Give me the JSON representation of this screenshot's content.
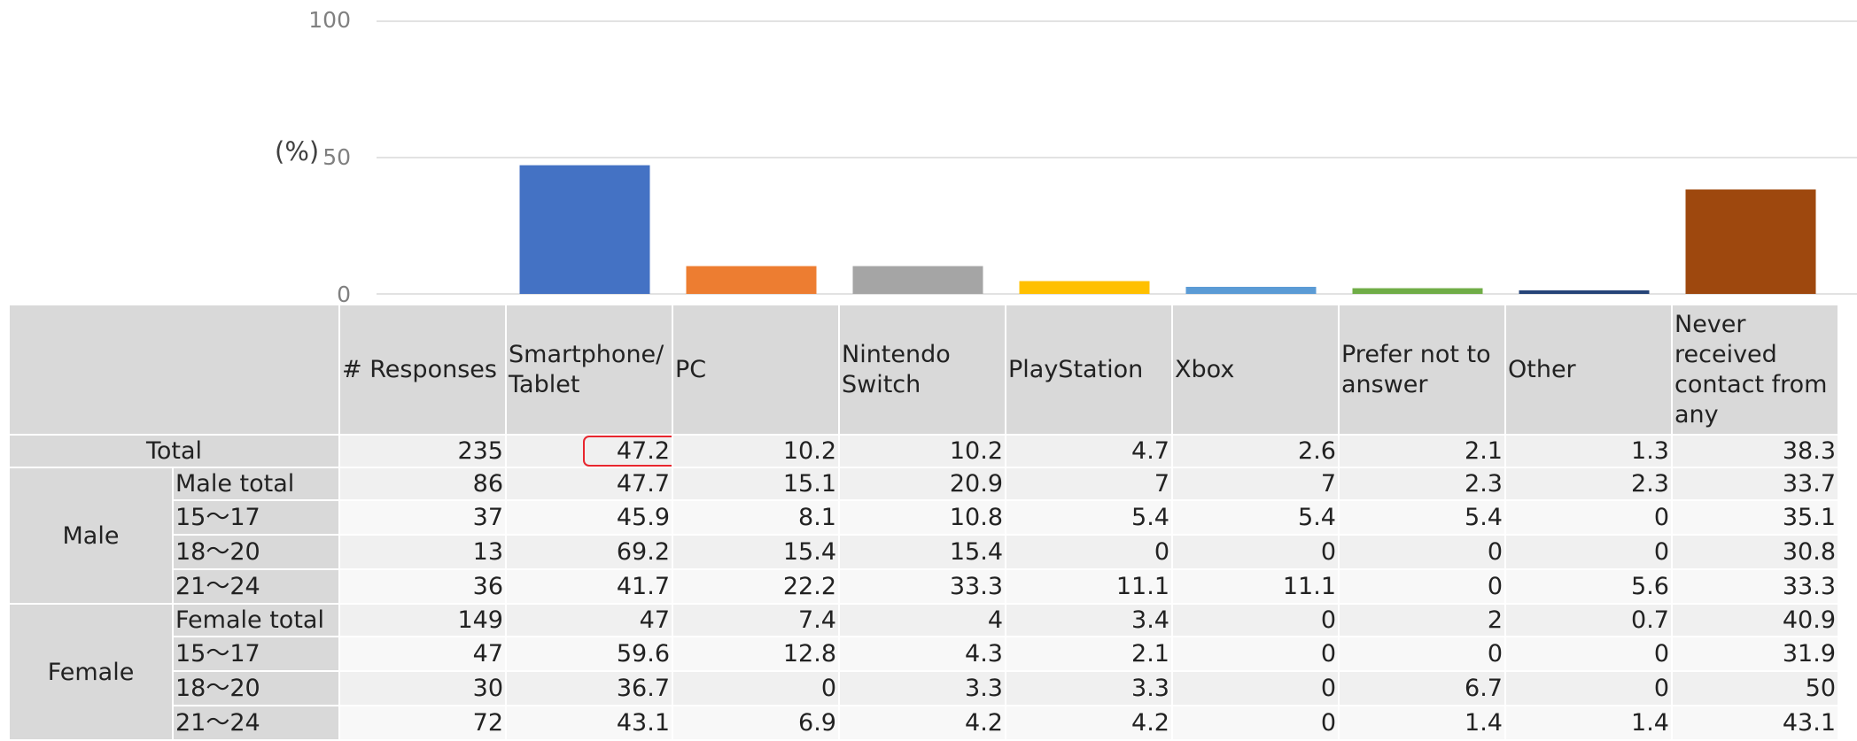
{
  "chart_data": {
    "type": "bar",
    "unit_label": "(%)",
    "y_ticks": [
      "100",
      "50",
      "0"
    ],
    "ylim": [
      0,
      100
    ],
    "grid": true,
    "categories": [
      "Smartphone/ Tablet",
      "PC",
      "Nintendo Switch",
      "PlayStation",
      "Xbox",
      "Prefer not to answer",
      "Other",
      "Never received contact from any"
    ],
    "values": [
      47.2,
      10.2,
      10.2,
      4.7,
      2.6,
      2.1,
      1.3,
      38.3
    ],
    "colors": [
      "#4472c4",
      "#ed7d31",
      "#a5a5a5",
      "#ffc000",
      "#5b9bd5",
      "#70ad47",
      "#264478",
      "#9e480e"
    ]
  },
  "table": {
    "header": {
      "responses": "# Responses",
      "c1": "Smartphone/ Tablet",
      "c2": "PC",
      "c3": "Nintendo Switch",
      "c4": "PlayStation",
      "c5": "Xbox",
      "c6": "Prefer not to answer",
      "c7": "Other",
      "c8": "Never received contact from any"
    },
    "total": {
      "label": "Total",
      "values": [
        "235",
        "47.2",
        "10.2",
        "10.2",
        "4.7",
        "2.6",
        "2.1",
        "1.3",
        "38.3"
      ]
    },
    "male": {
      "group": "Male",
      "rows": [
        {
          "label": "Male total",
          "values": [
            "86",
            "47.7",
            "15.1",
            "20.9",
            "7",
            "7",
            "2.3",
            "2.3",
            "33.7"
          ]
        },
        {
          "label": "15～17",
          "values": [
            "37",
            "45.9",
            "8.1",
            "10.8",
            "5.4",
            "5.4",
            "5.4",
            "0",
            "35.1"
          ]
        },
        {
          "label": "18～20",
          "values": [
            "13",
            "69.2",
            "15.4",
            "15.4",
            "0",
            "0",
            "0",
            "0",
            "30.8"
          ]
        },
        {
          "label": "21～24",
          "values": [
            "36",
            "41.7",
            "22.2",
            "33.3",
            "11.1",
            "11.1",
            "0",
            "5.6",
            "33.3"
          ]
        }
      ]
    },
    "female": {
      "group": "Female",
      "rows": [
        {
          "label": "Female total",
          "values": [
            "149",
            "47",
            "7.4",
            "4",
            "3.4",
            "0",
            "2",
            "0.7",
            "40.9"
          ]
        },
        {
          "label": "15～17",
          "values": [
            "47",
            "59.6",
            "12.8",
            "4.3",
            "2.1",
            "0",
            "0",
            "0",
            "31.9"
          ]
        },
        {
          "label": "18～20",
          "values": [
            "30",
            "36.7",
            "0",
            "3.3",
            "3.3",
            "0",
            "6.7",
            "0",
            "50"
          ]
        },
        {
          "label": "21～24",
          "values": [
            "72",
            "43.1",
            "6.9",
            "4.2",
            "4.2",
            "0",
            "1.4",
            "1.4",
            "43.1"
          ]
        }
      ]
    }
  }
}
